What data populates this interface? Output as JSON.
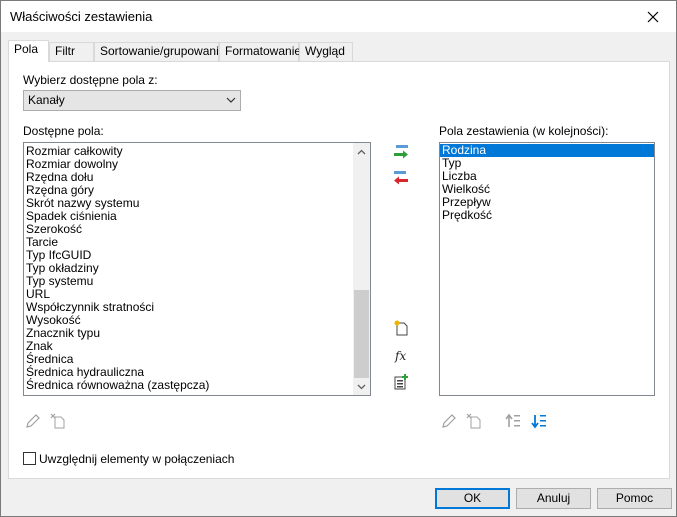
{
  "window": {
    "title": "Właściwości zestawienia"
  },
  "tabs": [
    {
      "label": "Pola",
      "active": true
    },
    {
      "label": "Filtr"
    },
    {
      "label": "Sortowanie/grupowanie"
    },
    {
      "label": "Formatowanie"
    },
    {
      "label": "Wygląd"
    }
  ],
  "source": {
    "label": "Wybierz dostępne pola z:",
    "value": "Kanały"
  },
  "available": {
    "label": "Dostępne pola:",
    "items": [
      "Rozmiar całkowity",
      "Rozmiar dowolny",
      "Rzędna dołu",
      "Rzędna góry",
      "Skrót nazwy systemu",
      "Spadek ciśnienia",
      "Szerokość",
      "Tarcie",
      "Typ IfcGUID",
      "Typ okładziny",
      "Typ systemu",
      "URL",
      "Współczynnik stratności",
      "Wysokość",
      "Znacznik typu",
      "Znak",
      "Średnica",
      "Średnica hydrauliczna",
      "Średnica równoważna (zastępcza)"
    ],
    "scroll_position": 0.9
  },
  "scheduled": {
    "label": "Pola zestawienia (w kolejności):",
    "items": [
      "Rodzina",
      "Typ",
      "Liczba",
      "Wielkość",
      "Przepływ",
      "Prędkość"
    ],
    "selected_index": 0
  },
  "checkbox": {
    "label": "Uwzględnij elementy w połączeniach",
    "checked": false
  },
  "buttons": {
    "ok": "OK",
    "cancel": "Anuluj",
    "help": "Pomoc"
  },
  "colors": {
    "accent": "#0078d7",
    "add_arrow": "#2e9e3a",
    "remove_arrow": "#d9262c"
  }
}
